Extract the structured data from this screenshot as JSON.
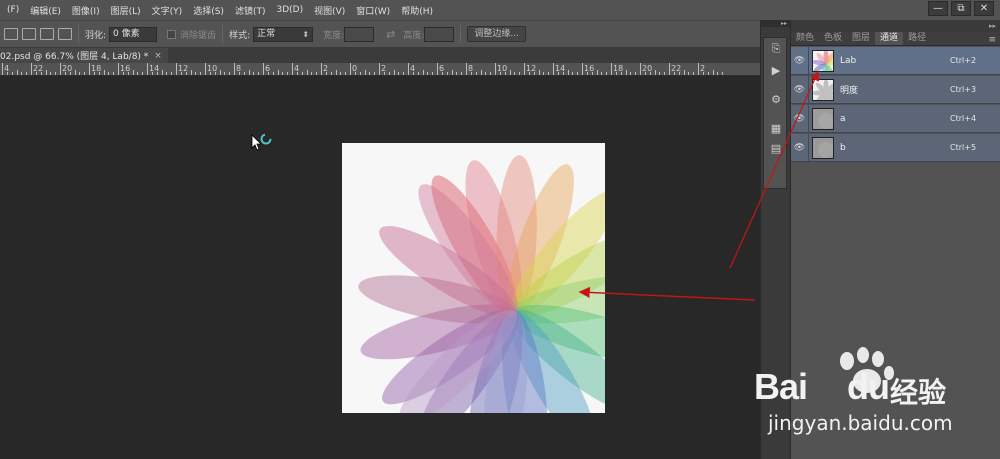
{
  "menu": [
    "(F)",
    "编辑(E)",
    "图像(I)",
    "图层(L)",
    "文字(Y)",
    "选择(S)",
    "滤镜(T)",
    "3D(D)",
    "视图(V)",
    "窗口(W)",
    "帮助(H)"
  ],
  "window_buttons": {
    "minimize": "—",
    "restore": "⧉",
    "close": "✕"
  },
  "options": {
    "feather_label": "羽化:",
    "feather_value": "0 像素",
    "antialias_label": "消除锯齿",
    "style_label": "样式:",
    "style_value": "正常",
    "width_label": "宽度:",
    "height_label": "高度:",
    "refine_button": "调整边缘..."
  },
  "document_tab": {
    "title": "02.psd @ 66.7% (图层 4, Lab/8) *",
    "close": "×"
  },
  "ruler_labels": [
    "4",
    "22",
    "20",
    "18",
    "16",
    "14",
    "12",
    "10",
    "8",
    "6",
    "4",
    "2",
    "0",
    "2",
    "4",
    "6",
    "8",
    "10",
    "12",
    "14",
    "16",
    "18",
    "20",
    "22",
    "2"
  ],
  "panel": {
    "tabs": [
      "颜色",
      "色板",
      "图层",
      "通道",
      "路径"
    ],
    "active_tab": "通道",
    "channels": [
      {
        "name": "Lab",
        "shortcut": "Ctrl+2",
        "thumb": "color"
      },
      {
        "name": "明度",
        "shortcut": "Ctrl+3",
        "thumb": "gray"
      },
      {
        "name": "a",
        "shortcut": "Ctrl+4",
        "thumb": "gray-dim"
      },
      {
        "name": "b",
        "shortcut": "Ctrl+5",
        "thumb": "gray-dim"
      }
    ]
  },
  "watermark": {
    "brand": "Bai",
    "brand2": "du",
    "cn": "经验",
    "url": "jingyan.baidu.com"
  },
  "colors": {
    "arrow": "#c81414",
    "panel_row": "#5d6677"
  }
}
